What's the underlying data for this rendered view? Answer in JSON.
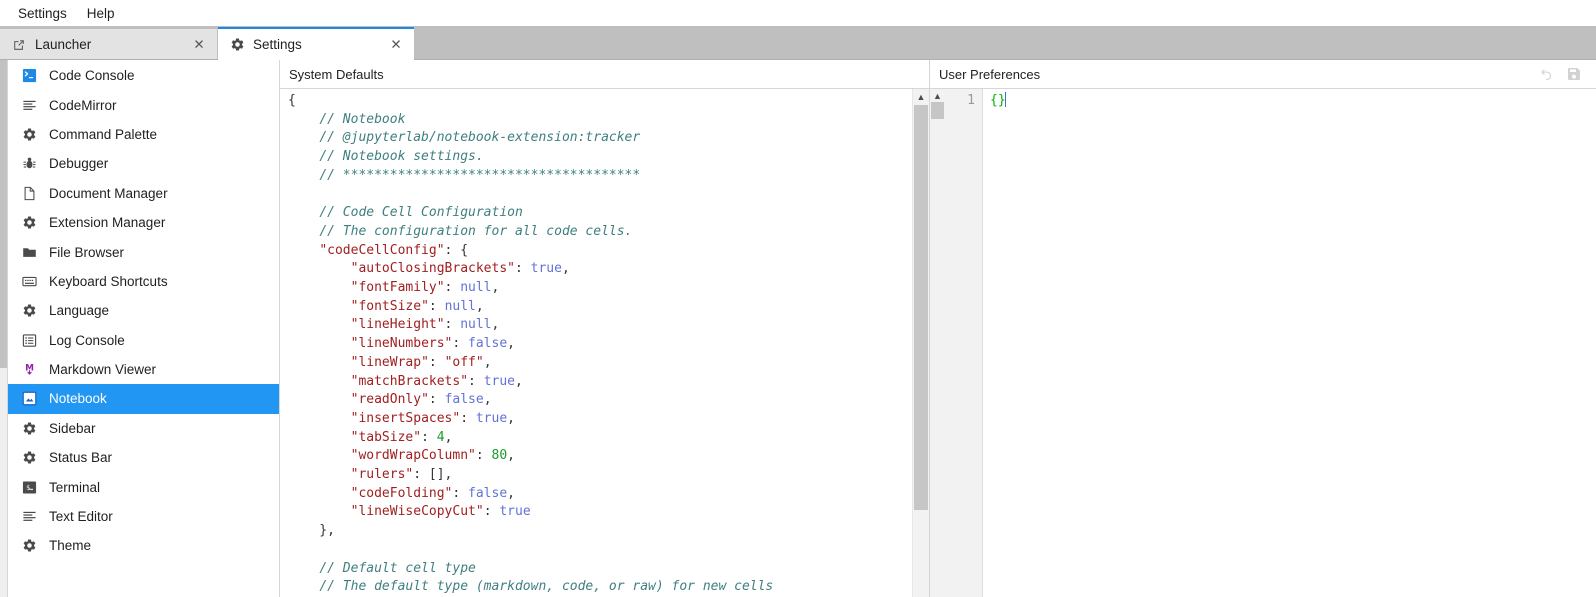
{
  "menubar": {
    "items": [
      {
        "label": "Settings",
        "name": "menu-settings"
      },
      {
        "label": "Help",
        "name": "menu-help"
      }
    ]
  },
  "tabs": [
    {
      "label": "Launcher",
      "icon": "external-link-icon",
      "active": false,
      "close_label": "✕"
    },
    {
      "label": "Settings",
      "icon": "gear-icon",
      "active": true,
      "close_label": "✕"
    }
  ],
  "sidebar": {
    "items": [
      {
        "label": "Code Console",
        "icon": "code-console-icon",
        "selected": false
      },
      {
        "label": "CodeMirror",
        "icon": "text-lines-icon",
        "selected": false
      },
      {
        "label": "Command Palette",
        "icon": "gear-icon",
        "selected": false
      },
      {
        "label": "Debugger",
        "icon": "bug-icon",
        "selected": false
      },
      {
        "label": "Document Manager",
        "icon": "file-icon",
        "selected": false
      },
      {
        "label": "Extension Manager",
        "icon": "gear-icon",
        "selected": false
      },
      {
        "label": "File Browser",
        "icon": "folder-icon",
        "selected": false
      },
      {
        "label": "Keyboard Shortcuts",
        "icon": "keyboard-icon",
        "selected": false
      },
      {
        "label": "Language",
        "icon": "gear-icon",
        "selected": false
      },
      {
        "label": "Log Console",
        "icon": "list-box-icon",
        "selected": false
      },
      {
        "label": "Markdown Viewer",
        "icon": "markdown-icon",
        "selected": false
      },
      {
        "label": "Notebook",
        "icon": "notebook-icon",
        "selected": true
      },
      {
        "label": "Sidebar",
        "icon": "gear-icon",
        "selected": false
      },
      {
        "label": "Status Bar",
        "icon": "gear-icon",
        "selected": false
      },
      {
        "label": "Terminal",
        "icon": "terminal-icon",
        "selected": false
      },
      {
        "label": "Text Editor",
        "icon": "text-lines-icon",
        "selected": false
      },
      {
        "label": "Theme",
        "icon": "gear-icon",
        "selected": false
      }
    ]
  },
  "system_defaults": {
    "title": "System Defaults",
    "code_lines": [
      [
        {
          "t": "{",
          "c": "punct"
        }
      ],
      [
        {
          "t": "    ",
          "c": "punct"
        },
        {
          "t": "// Notebook",
          "c": "comment"
        }
      ],
      [
        {
          "t": "    ",
          "c": "punct"
        },
        {
          "t": "// @jupyterlab/notebook-extension:tracker",
          "c": "comment"
        }
      ],
      [
        {
          "t": "    ",
          "c": "punct"
        },
        {
          "t": "// Notebook settings.",
          "c": "comment"
        }
      ],
      [
        {
          "t": "    ",
          "c": "punct"
        },
        {
          "t": "// **************************************",
          "c": "comment"
        }
      ],
      [
        {
          "t": "",
          "c": "punct"
        }
      ],
      [
        {
          "t": "    ",
          "c": "punct"
        },
        {
          "t": "// Code Cell Configuration",
          "c": "comment"
        }
      ],
      [
        {
          "t": "    ",
          "c": "punct"
        },
        {
          "t": "// The configuration for all code cells.",
          "c": "comment"
        }
      ],
      [
        {
          "t": "    ",
          "c": "punct"
        },
        {
          "t": "\"codeCellConfig\"",
          "c": "key"
        },
        {
          "t": ": {",
          "c": "punct"
        }
      ],
      [
        {
          "t": "        ",
          "c": "punct"
        },
        {
          "t": "\"autoClosingBrackets\"",
          "c": "key"
        },
        {
          "t": ": ",
          "c": "punct"
        },
        {
          "t": "true",
          "c": "atom"
        },
        {
          "t": ",",
          "c": "punct"
        }
      ],
      [
        {
          "t": "        ",
          "c": "punct"
        },
        {
          "t": "\"fontFamily\"",
          "c": "key"
        },
        {
          "t": ": ",
          "c": "punct"
        },
        {
          "t": "null",
          "c": "atom"
        },
        {
          "t": ",",
          "c": "punct"
        }
      ],
      [
        {
          "t": "        ",
          "c": "punct"
        },
        {
          "t": "\"fontSize\"",
          "c": "key"
        },
        {
          "t": ": ",
          "c": "punct"
        },
        {
          "t": "null",
          "c": "atom"
        },
        {
          "t": ",",
          "c": "punct"
        }
      ],
      [
        {
          "t": "        ",
          "c": "punct"
        },
        {
          "t": "\"lineHeight\"",
          "c": "key"
        },
        {
          "t": ": ",
          "c": "punct"
        },
        {
          "t": "null",
          "c": "atom"
        },
        {
          "t": ",",
          "c": "punct"
        }
      ],
      [
        {
          "t": "        ",
          "c": "punct"
        },
        {
          "t": "\"lineNumbers\"",
          "c": "key"
        },
        {
          "t": ": ",
          "c": "punct"
        },
        {
          "t": "false",
          "c": "atom"
        },
        {
          "t": ",",
          "c": "punct"
        }
      ],
      [
        {
          "t": "        ",
          "c": "punct"
        },
        {
          "t": "\"lineWrap\"",
          "c": "key"
        },
        {
          "t": ": ",
          "c": "punct"
        },
        {
          "t": "\"off\"",
          "c": "string"
        },
        {
          "t": ",",
          "c": "punct"
        }
      ],
      [
        {
          "t": "        ",
          "c": "punct"
        },
        {
          "t": "\"matchBrackets\"",
          "c": "key"
        },
        {
          "t": ": ",
          "c": "punct"
        },
        {
          "t": "true",
          "c": "atom"
        },
        {
          "t": ",",
          "c": "punct"
        }
      ],
      [
        {
          "t": "        ",
          "c": "punct"
        },
        {
          "t": "\"readOnly\"",
          "c": "key"
        },
        {
          "t": ": ",
          "c": "punct"
        },
        {
          "t": "false",
          "c": "atom"
        },
        {
          "t": ",",
          "c": "punct"
        }
      ],
      [
        {
          "t": "        ",
          "c": "punct"
        },
        {
          "t": "\"insertSpaces\"",
          "c": "key"
        },
        {
          "t": ": ",
          "c": "punct"
        },
        {
          "t": "true",
          "c": "atom"
        },
        {
          "t": ",",
          "c": "punct"
        }
      ],
      [
        {
          "t": "        ",
          "c": "punct"
        },
        {
          "t": "\"tabSize\"",
          "c": "key"
        },
        {
          "t": ": ",
          "c": "punct"
        },
        {
          "t": "4",
          "c": "number"
        },
        {
          "t": ",",
          "c": "punct"
        }
      ],
      [
        {
          "t": "        ",
          "c": "punct"
        },
        {
          "t": "\"wordWrapColumn\"",
          "c": "key"
        },
        {
          "t": ": ",
          "c": "punct"
        },
        {
          "t": "80",
          "c": "number"
        },
        {
          "t": ",",
          "c": "punct"
        }
      ],
      [
        {
          "t": "        ",
          "c": "punct"
        },
        {
          "t": "\"rulers\"",
          "c": "key"
        },
        {
          "t": ": [],",
          "c": "punct"
        }
      ],
      [
        {
          "t": "        ",
          "c": "punct"
        },
        {
          "t": "\"codeFolding\"",
          "c": "key"
        },
        {
          "t": ": ",
          "c": "punct"
        },
        {
          "t": "false",
          "c": "atom"
        },
        {
          "t": ",",
          "c": "punct"
        }
      ],
      [
        {
          "t": "        ",
          "c": "punct"
        },
        {
          "t": "\"lineWiseCopyCut\"",
          "c": "key"
        },
        {
          "t": ": ",
          "c": "punct"
        },
        {
          "t": "true",
          "c": "atom"
        }
      ],
      [
        {
          "t": "    },",
          "c": "punct"
        }
      ],
      [
        {
          "t": "",
          "c": "punct"
        }
      ],
      [
        {
          "t": "    ",
          "c": "punct"
        },
        {
          "t": "// Default cell type",
          "c": "comment"
        }
      ],
      [
        {
          "t": "    ",
          "c": "punct"
        },
        {
          "t": "// The default type (markdown, code, or raw) for new cells",
          "c": "comment"
        }
      ]
    ]
  },
  "user_preferences": {
    "title": "User Preferences",
    "tools": [
      {
        "name": "undo-icon",
        "label": "↶"
      },
      {
        "name": "save-icon",
        "label": "💾"
      }
    ],
    "line_numbers": [
      "1"
    ],
    "code": "{}"
  },
  "colors": {
    "accent": "#2196f3",
    "tab_active_border": "#1e88e5",
    "comment": "#3f7f7f",
    "key": "#a11f1f",
    "atom": "#6272d6",
    "number": "#1a9c28",
    "user_bracket": "#00b300",
    "tabbar_bg": "#bfbfbf"
  }
}
